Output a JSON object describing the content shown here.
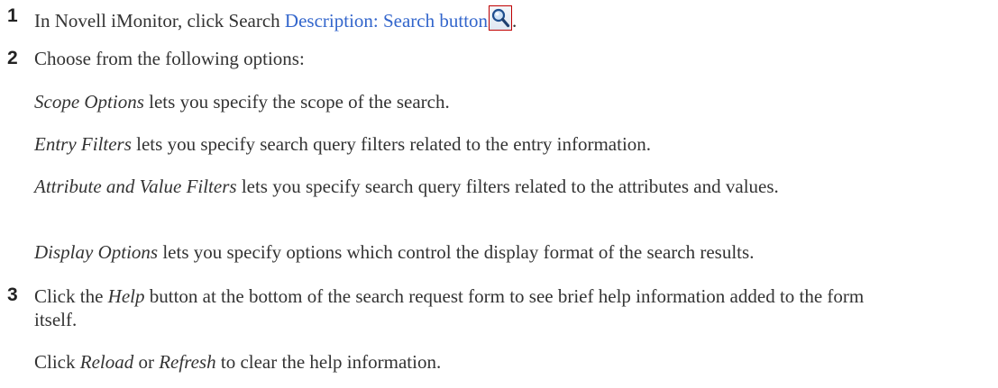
{
  "steps": [
    {
      "number": "1",
      "intro": "In Novell iMonitor, click Search ",
      "link_text": "Description: Search button",
      "icon": "search-icon",
      "trailing": "."
    },
    {
      "number": "2",
      "text": "Choose from the following options:",
      "options": [
        {
          "term": "Scope Options",
          "desc": " lets you specify the scope of the search."
        },
        {
          "term": "Entry Filters",
          "desc": " lets you specify search query filters related to the entry information."
        },
        {
          "term": "Attribute and Value Filters",
          "desc": " lets you specify search query filters related to the attributes and values."
        },
        {
          "term": "Display Options",
          "desc": " lets you specify options which control the display format of the search results."
        }
      ]
    },
    {
      "number": "3",
      "pre": "Click the ",
      "term": "Help",
      "post": " button at the bottom of the search request form to see brief help information added to the form itself.",
      "followup": {
        "pre": "Click ",
        "term1": "Reload",
        "mid": " or ",
        "term2": "Refresh",
        "post": " to clear the help information."
      }
    }
  ],
  "colors": {
    "text": "#333333",
    "link": "#3366cc",
    "icon_border": "#c00000"
  }
}
